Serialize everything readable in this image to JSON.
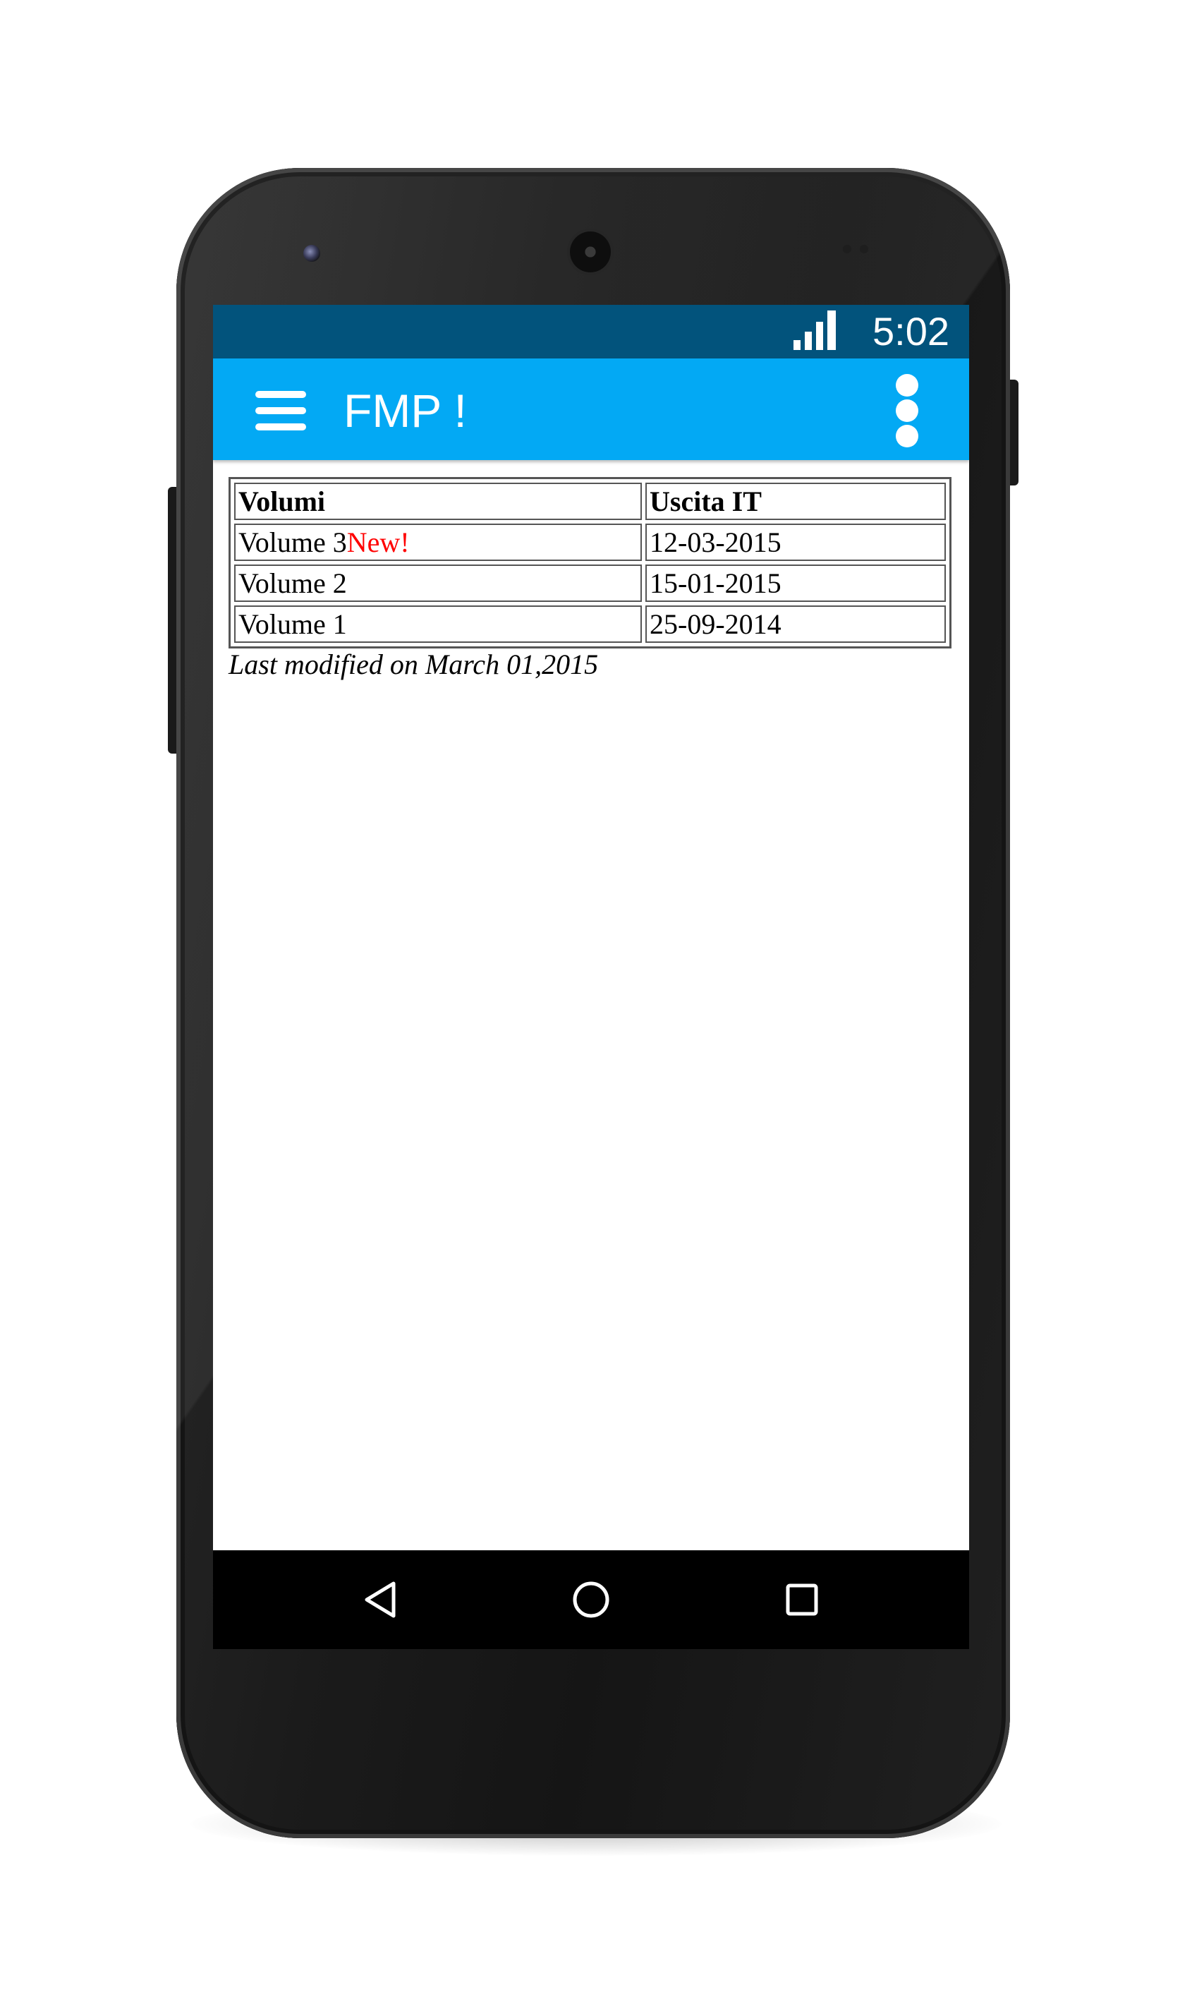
{
  "status_bar": {
    "time": "5:02",
    "signal_icon": "cellular-signal-icon",
    "background": "#02537c"
  },
  "app_bar": {
    "title": "FMP !",
    "menu_icon": "hamburger-menu-icon",
    "overflow_icon": "overflow-menu-icon",
    "background": "#03a9f4"
  },
  "table": {
    "headers": [
      "Volumi",
      "Uscita IT"
    ],
    "rows": [
      {
        "volume": "Volume 3",
        "badge": "New!",
        "date": "12-03-2015"
      },
      {
        "volume": "Volume 2",
        "badge": "",
        "date": "15-01-2015"
      },
      {
        "volume": "Volume 1",
        "badge": "",
        "date": "25-09-2014"
      }
    ],
    "badge_color": "#ff0000"
  },
  "footer_note": "Last modified on March 01,2015",
  "nav_bar": {
    "back_icon": "back-triangle-icon",
    "home_icon": "home-circle-icon",
    "recents_icon": "recents-square-icon"
  }
}
